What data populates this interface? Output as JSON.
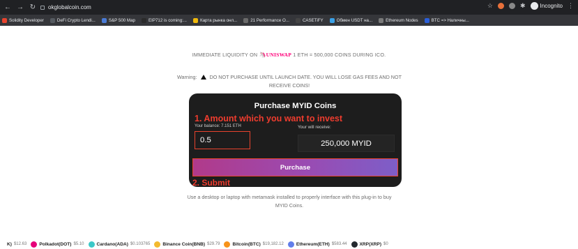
{
  "browser": {
    "url": "okglobalcoin.com",
    "profile_label": "Incognito",
    "bookmarks": [
      {
        "label": "Solidity Developer",
        "color": "#e8432d"
      },
      {
        "label": "DeFi Crypto Lendi...",
        "color": "#555a60"
      },
      {
        "label": "S&P 500 Map",
        "color": "#4a7bd6"
      },
      {
        "label": "EIP712 is coming:...",
        "color": "#2a2a2a"
      },
      {
        "label": "Карта рынка онл...",
        "color": "#f0b90b"
      },
      {
        "label": "21 Performance O...",
        "color": "#6b6b6b"
      },
      {
        "label": "CASETiFY",
        "color": "#444"
      },
      {
        "label": "Обмен USDT на...",
        "color": "#3aa0e6"
      },
      {
        "label": "Ethereum Nodes",
        "color": "#7a7a7a"
      },
      {
        "label": "BTC => Наличны...",
        "color": "#2b5fd9"
      }
    ]
  },
  "page": {
    "liquidity_prefix": "IMMEDIATE LIQUIDITY ON",
    "liquidity_brand": "UNISWAP",
    "liquidity_suffix": "1 ETH = 500,000 COINS DURING ICO.",
    "warning_prefix": "Warning:",
    "warning_text": "DO NOT PURCHASE UNTIL LAUNCH DATE. YOU WILL LOSE GAS FEES AND NOT RECEIVE COINS!",
    "card": {
      "title": "Purchase MYID Coins",
      "annotation_amount": "1. Amount which you want to invest",
      "balance_label": "Your balance: 7.151 ETH",
      "receive_label": "Your will receive:",
      "amount_value": "0.5",
      "receive_value": "250,000 MYID",
      "purchase_label": "Purchase",
      "annotation_submit": "2. Submit"
    },
    "hint": "Use a desktop or laptop with metamask installed to properly interface with this plug-in to buy MYID Coins."
  },
  "ticker": [
    {
      "name": "K)",
      "price": "$12.63",
      "color": "#ffffff"
    },
    {
      "name": "Polkadot(DOT)",
      "price": "$5.10",
      "color": "#e6007a"
    },
    {
      "name": "Cardano(ADA)",
      "price": "$0.103765",
      "color": "#3cc8c8"
    },
    {
      "name": "Binance Coin(BNB)",
      "price": "$29.79",
      "color": "#f3ba2f"
    },
    {
      "name": "Bitcoin(BTC)",
      "price": "$19,182.12",
      "color": "#f7931a"
    },
    {
      "name": "Ethereum(ETH)",
      "price": "$583.44",
      "color": "#627eea"
    },
    {
      "name": "XRP(XRP)",
      "price": "$0",
      "color": "#23292f"
    }
  ]
}
